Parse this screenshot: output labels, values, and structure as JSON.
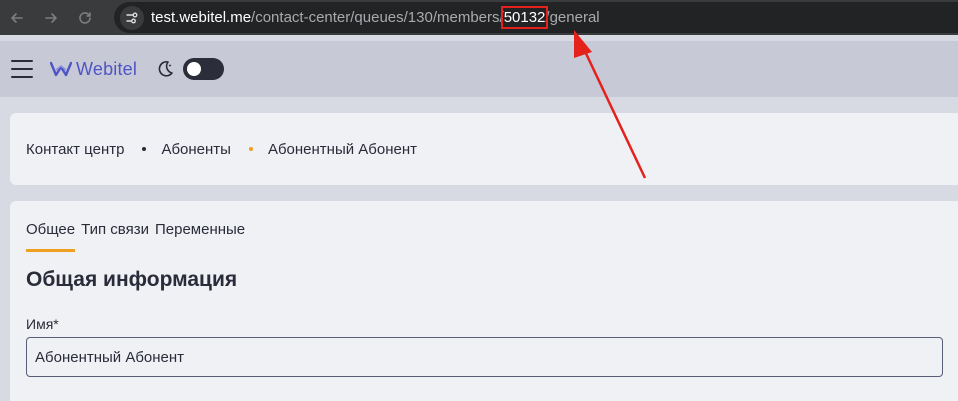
{
  "browser": {
    "url_host": "test.webitel.me",
    "url_path": "/contact-center/queues/130/members/",
    "url_id": "50132",
    "url_tail": "/general",
    "icons": [
      "back-icon",
      "forward-icon",
      "reload-icon",
      "site-settings-icon"
    ]
  },
  "header": {
    "logo_text": "Webitel",
    "theme_toggle": "dark-mode-toggle"
  },
  "breadcrumb": {
    "items": [
      "Контакт центр",
      "Абоненты",
      "Абонентный Абонент"
    ]
  },
  "tabs": [
    {
      "label": "Общее",
      "active": true
    },
    {
      "label": "Тип связи",
      "active": false
    },
    {
      "label": "Переменные",
      "active": false
    }
  ],
  "section": {
    "title": "Общая информация",
    "name_label": "Имя*",
    "name_value": "Абонентный Абонент"
  },
  "colors": {
    "accent": "#f0a020",
    "highlight": "#e5211c",
    "brand": "#4e55c4"
  }
}
